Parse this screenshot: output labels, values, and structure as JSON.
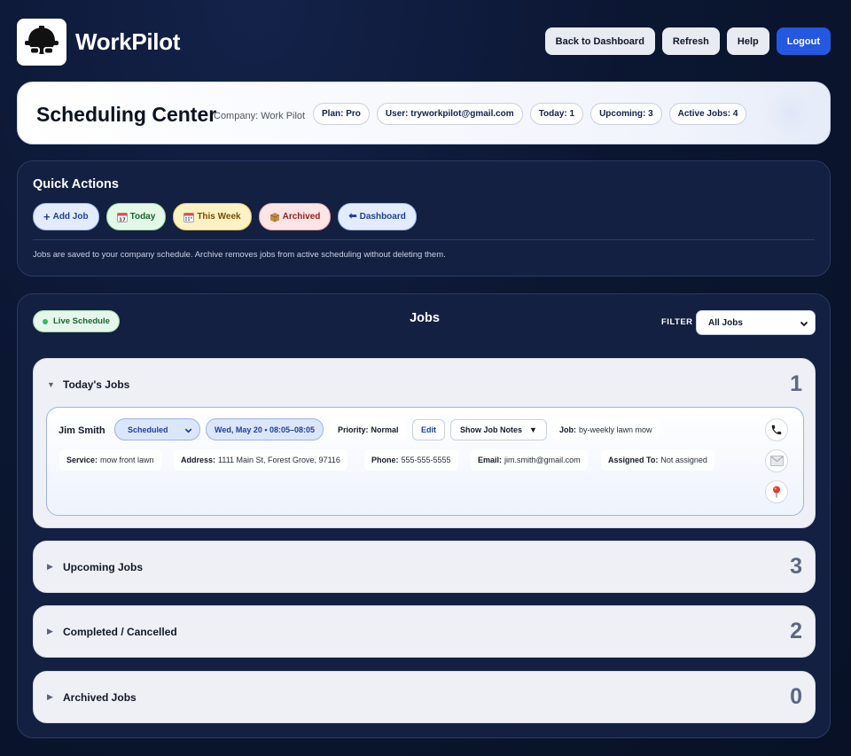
{
  "app": {
    "brand": "WorkPilot",
    "top_buttons": {
      "back": "Back to Dashboard",
      "refresh": "Refresh",
      "help": "Help",
      "logout": "Logout"
    }
  },
  "header": {
    "title": "Scheduling Center",
    "company": "Company: Work Pilot",
    "pills": {
      "plan": "Plan: Pro",
      "user": "User: tryworkpilot@gmail.com",
      "today": "Today: 1",
      "upcoming": "Upcoming: 3",
      "active": "Active Jobs: 4"
    }
  },
  "quick_actions": {
    "title": "Quick Actions",
    "buttons": {
      "add_job": "Add Job",
      "today": "Today",
      "this_week": "This Week",
      "archived": "Archived",
      "dashboard": "Dashboard"
    },
    "note": "Jobs are saved to your company schedule. Archive removes jobs from active scheduling without deleting them."
  },
  "jobs": {
    "live_badge": "Live Schedule",
    "title": "Jobs",
    "filter_label": "FILTER",
    "filter_value": "All Jobs",
    "sections": {
      "today": {
        "title": "Today's Jobs",
        "count": "1"
      },
      "upcoming": {
        "title": "Upcoming Jobs",
        "count": "3"
      },
      "completed": {
        "title": "Completed / Cancelled",
        "count": "2"
      },
      "archived": {
        "title": "Archived Jobs",
        "count": "0"
      }
    },
    "job": {
      "name": "Jim Smith",
      "status": "Scheduled",
      "datetime": "Wed, May 20 • 08:05–08:05",
      "priority_label": "Priority:",
      "priority_value": "Normal",
      "edit": "Edit",
      "show_notes": "Show Job Notes",
      "job_label": "Job:",
      "job_value": "by-weekly lawn mow",
      "service_label": "Service:",
      "service_value": "mow front lawn",
      "address_label": "Address:",
      "address_value": "1111 Main St, Forest Grove, 97116",
      "phone_label": "Phone:",
      "phone_value": "555-555-5555",
      "email_label": "Email:",
      "email_value": "jim.smith@gmail.com",
      "assigned_label": "Assigned To:",
      "assigned_value": "Not assigned"
    }
  },
  "icons": {
    "logo": "hard-hat-sunglasses-icon",
    "phone": "phone-icon",
    "email": "envelope-icon",
    "map": "map-pin-icon"
  },
  "colors": {
    "primary": "#2458e0",
    "background": "#0b1631",
    "live": "#22c55e"
  }
}
